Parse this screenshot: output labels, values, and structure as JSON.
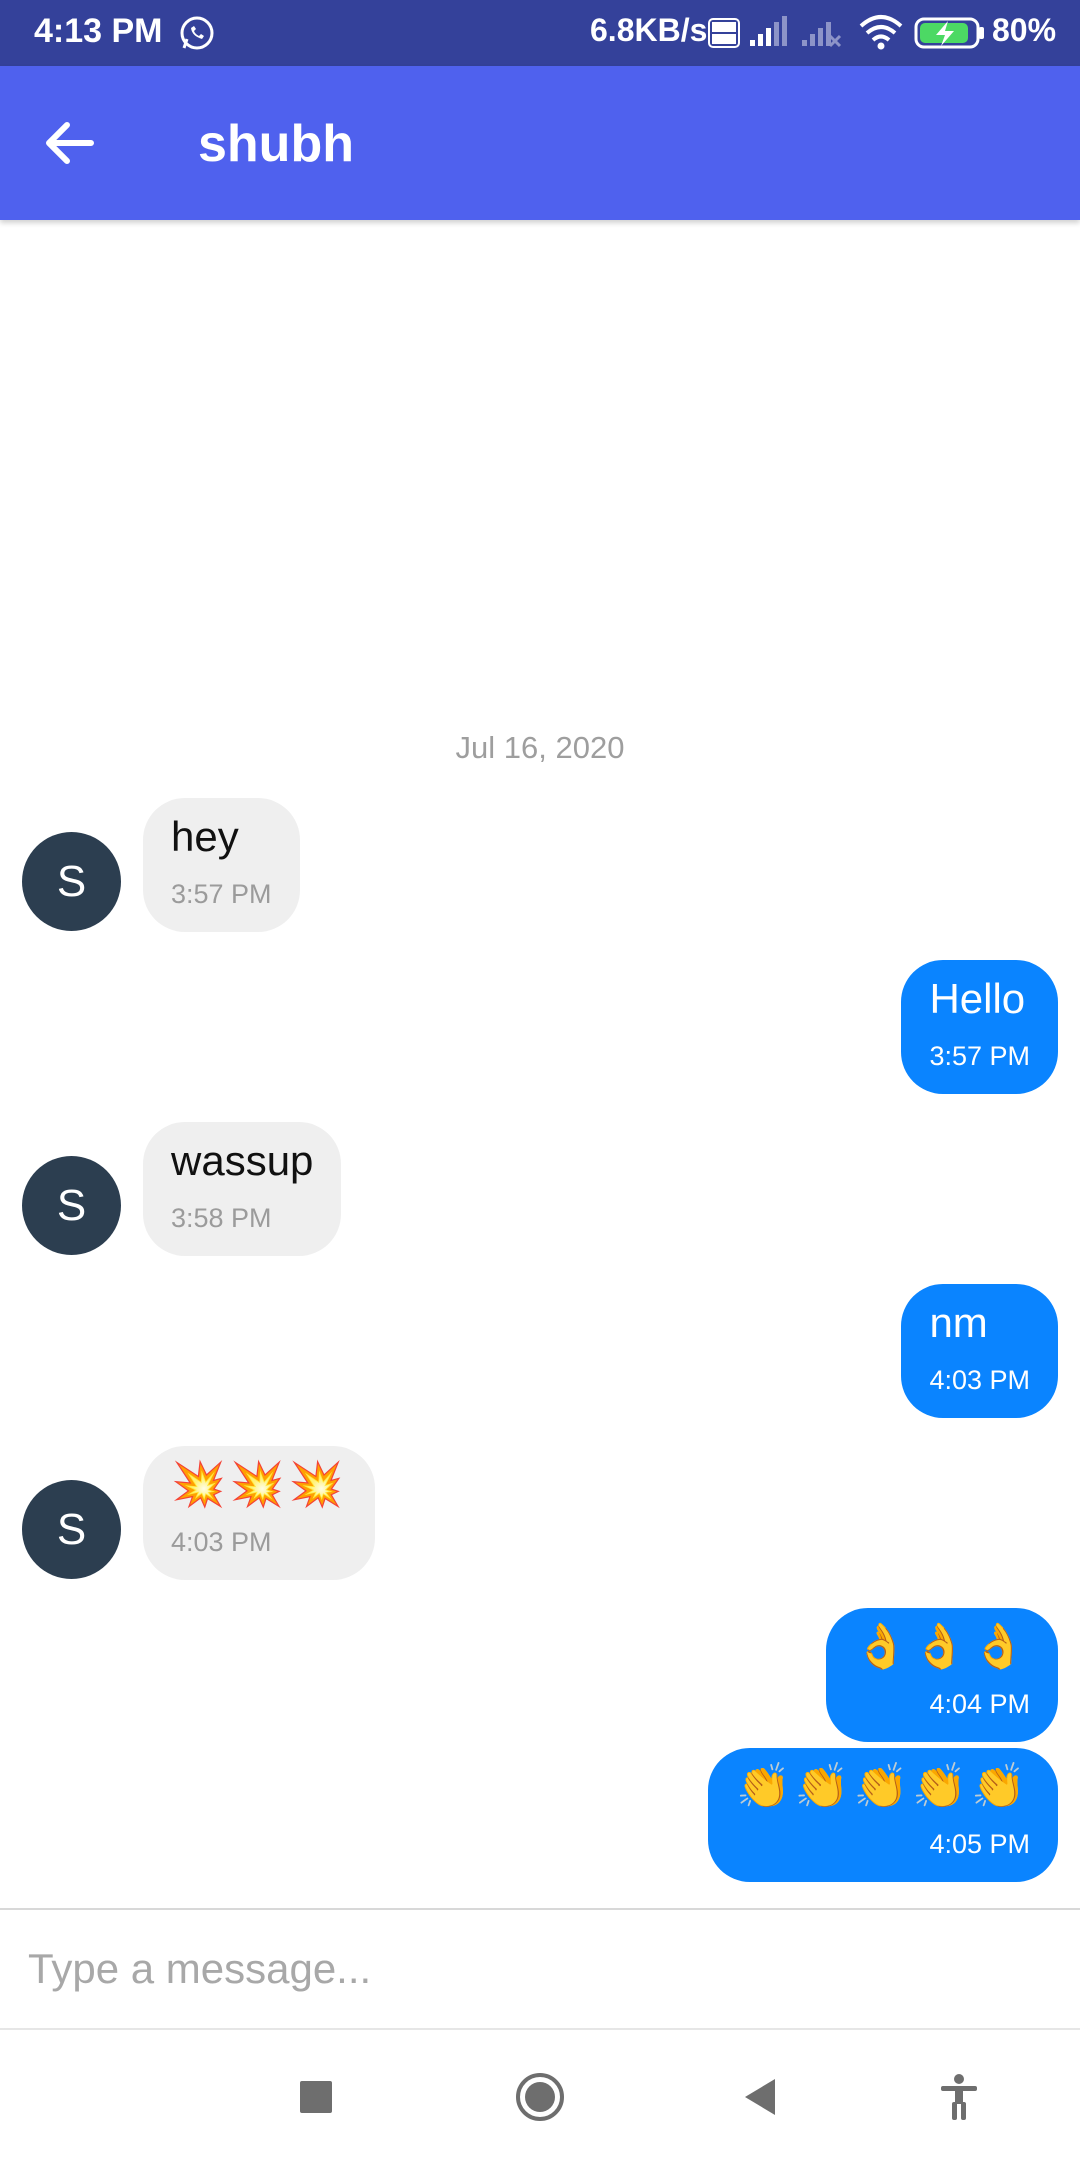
{
  "status_bar": {
    "time": "4:13 PM",
    "network_speed": "6.8KB/s",
    "volte_badge": "Vo LTE",
    "battery_percent": "80%",
    "icons": [
      "whatsapp-icon",
      "volte-icon",
      "signal-icon",
      "signal-no-service-icon",
      "wifi-icon",
      "battery-charging-icon"
    ]
  },
  "header": {
    "title": "shubh",
    "back_icon": "arrow-left-icon"
  },
  "chat": {
    "date_separator": "Jul 16, 2020",
    "avatar_initial": "S",
    "messages": [
      {
        "direction": "incoming",
        "text": "hey",
        "time": "3:57 PM"
      },
      {
        "direction": "outgoing",
        "text": "Hello",
        "time": "3:57 PM"
      },
      {
        "direction": "incoming",
        "text": "wassup",
        "time": "3:58 PM"
      },
      {
        "direction": "outgoing",
        "text": "nm",
        "time": "4:03 PM"
      },
      {
        "direction": "incoming",
        "text": "💥💥💥",
        "time": "4:03 PM"
      },
      {
        "direction": "outgoing",
        "text": "👌👌👌",
        "time": "4:04 PM"
      },
      {
        "direction": "outgoing",
        "text": "👏👏👏👏👏",
        "time": "4:05 PM"
      }
    ]
  },
  "composer": {
    "placeholder": "Type a message...",
    "value": ""
  },
  "nav_bar": {
    "buttons": [
      "recents-square-icon",
      "home-circle-icon",
      "back-triangle-icon",
      "accessibility-icon"
    ]
  },
  "colors": {
    "status_bar": "#34419a",
    "app_bar": "#4f61ee",
    "outgoing_bubble": "#0a84ff",
    "incoming_bubble": "#efefef",
    "avatar": "#2c3e50"
  }
}
